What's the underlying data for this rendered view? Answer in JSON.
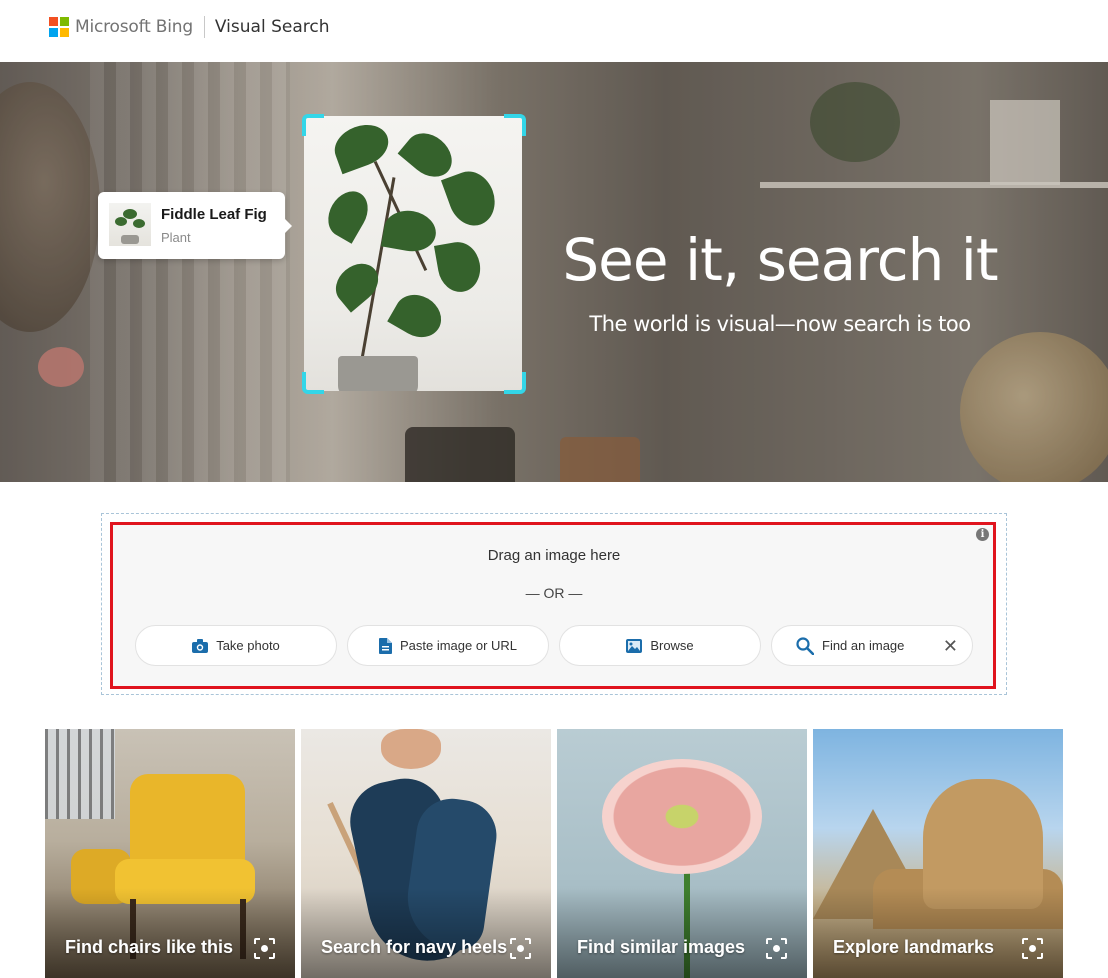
{
  "header": {
    "brand": "Microsoft Bing",
    "product": "Visual Search"
  },
  "hero": {
    "title": "See it, search it",
    "subtitle": "The world is visual—now search is too",
    "tag": {
      "title": "Fiddle Leaf Fig",
      "subtitle": "Plant"
    }
  },
  "upload": {
    "drag_text": "Drag an image here",
    "or_text": "— OR —",
    "buttons": [
      {
        "label": "Take photo",
        "icon": "camera-icon"
      },
      {
        "label": "Paste image or URL",
        "icon": "document-icon"
      },
      {
        "label": "Browse",
        "icon": "image-icon"
      },
      {
        "label": "Find an image",
        "icon": "search-icon"
      }
    ]
  },
  "cards": [
    {
      "label": "Find chairs like this",
      "icon": "visual-search-icon"
    },
    {
      "label": "Search for navy heels",
      "icon": "visual-search-icon"
    },
    {
      "label": "Find similar images",
      "icon": "visual-search-icon"
    },
    {
      "label": "Explore landmarks",
      "icon": "visual-search-icon"
    }
  ],
  "colors": {
    "accent_bracket": "#33d6e8",
    "highlight_border": "#e0141e",
    "icon_blue": "#1b6dab"
  }
}
